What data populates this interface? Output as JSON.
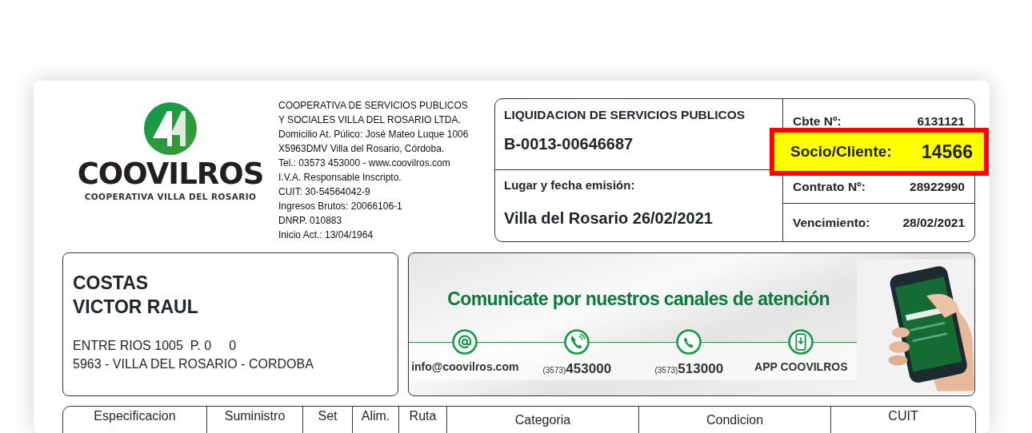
{
  "company": {
    "logo_name": "COOVILROS",
    "logo_subtitle": "COOPERATIVA VILLA DEL ROSARIO",
    "info_lines": [
      "COOPERATIVA DE SERVICIOS PUBLICOS",
      "Y SOCIALES VILLA DEL ROSARIO LTDA.",
      "Domicilio At. Púlico: José Mateo Luque 1006",
      "X5963DMV Villa del Rosario, Córdoba.",
      "Tel.: 03573 453000 - www.coovilros.com",
      "I.V.A. Responsable Inscripto.",
      "CUIT: 30-54564042-9",
      "Ingresos Brutos: 20066106-1",
      "DNRP. 010883",
      "Inicio Act.: 13/04/1964"
    ]
  },
  "invoice": {
    "title": "LIQUIDACION DE SERVICIOS PUBLICOS",
    "number": "B-0013-00646687",
    "place_date_label": "Lugar y fecha emisión:",
    "place_date": "Villa del Rosario 26/02/2021"
  },
  "fields": [
    {
      "label": "Cbte Nº:",
      "value": "6131121",
      "highlighted": false
    },
    {
      "label": "Socio/Cliente:",
      "value": "14566",
      "highlighted": true
    },
    {
      "label": "Contrato Nº:",
      "value": "28922990",
      "highlighted": false
    },
    {
      "label": "Vencimiento:",
      "value": "28/02/2021",
      "highlighted": false
    }
  ],
  "customer": {
    "name_lines": [
      "COSTAS",
      "VICTOR RAUL"
    ],
    "address_lines": [
      "ENTRE RIOS 1005  P. 0     0",
      "5963 - VILLA DEL ROSARIO - CORDOBA"
    ]
  },
  "banner": {
    "heading": "Comunicate por nuestros canales de atención",
    "channels": [
      {
        "kind": "email",
        "text": "info@coovilros.com"
      },
      {
        "kind": "phone",
        "prefix": "(3573)",
        "text": "453000"
      },
      {
        "kind": "whatsapp",
        "prefix": "(3573)",
        "text": "513000"
      },
      {
        "kind": "app",
        "text": "APP COOVILROS"
      }
    ]
  },
  "table": {
    "columns": [
      "Especificacion",
      "Suministro",
      "Set",
      "Alim.",
      "Ruta",
      "Categoria",
      "Condicion",
      "CUIT"
    ]
  }
}
